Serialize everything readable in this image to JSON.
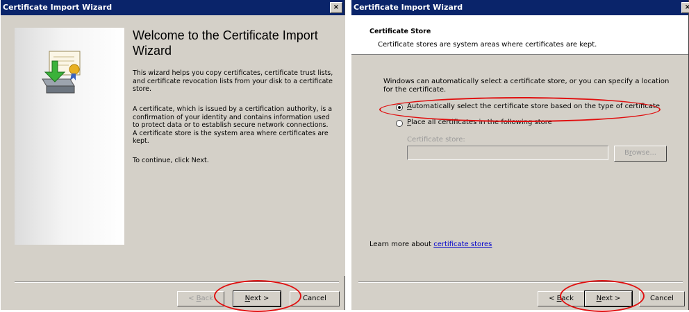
{
  "left_window": {
    "title": "Certificate Import Wizard",
    "close_label": "×",
    "heading": "Welcome to the Certificate Import Wizard",
    "para1": "This wizard helps you copy certificates, certificate trust lists, and certificate revocation lists from your disk to a certificate store.",
    "para2": "A certificate, which is issued by a certification authority, is a confirmation of your identity and contains information used to protect data or to establish secure network connections. A certificate store is the system area where certificates are kept.",
    "para3": "To continue, click Next.",
    "buttons": {
      "back": {
        "prefix": "< ",
        "access": "B",
        "rest": "ack"
      },
      "next": {
        "access": "N",
        "rest": "ext >"
      },
      "cancel": "Cancel"
    }
  },
  "right_window": {
    "title": "Certificate Import Wizard",
    "close_label": "×",
    "header_title": "Certificate Store",
    "header_subtitle": "Certificate stores are system areas where certificates are kept.",
    "description": "Windows can automatically select a certificate store, or you can specify a location for the certificate.",
    "option_auto": {
      "access": "A",
      "rest": "utomatically select the certificate store based on the type of certificate",
      "checked": true
    },
    "option_place": {
      "access": "P",
      "rest": "lace all certificates in the following store",
      "checked": false
    },
    "store_label": "Certificate store:",
    "store_value": "",
    "browse": {
      "prefix": "B",
      "access": "r",
      "rest": "owse..."
    },
    "learn_more_prefix": "Learn more about ",
    "learn_more_link": "certificate stores",
    "buttons": {
      "back": {
        "prefix": "< ",
        "access": "B",
        "rest": "ack"
      },
      "next": {
        "access": "N",
        "rest": "ext >"
      },
      "cancel": "Cancel"
    }
  },
  "colors": {
    "highlight_circle": "#e01010",
    "titlebar": "#0a246a",
    "dialog": "#d4d0c8"
  }
}
